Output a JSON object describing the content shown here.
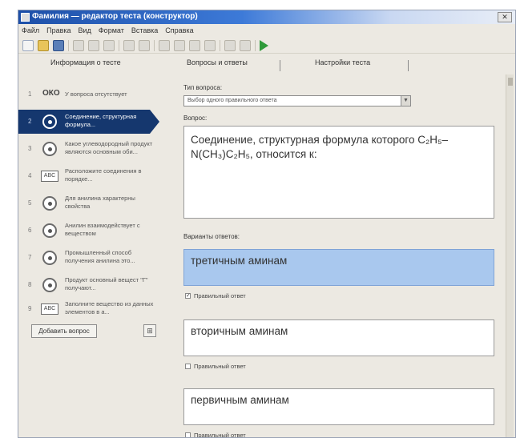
{
  "window": {
    "title": "Фамилия — редактор теста (конструктор)",
    "close_glyph": "✕"
  },
  "menu": [
    "Файл",
    "Правка",
    "Вид",
    "Формат",
    "Вставка",
    "Справка"
  ],
  "tabs": [
    "Информация о тесте",
    "Вопросы и ответы",
    "Настройки теста"
  ],
  "sidebar": {
    "items": [
      {
        "num": "1",
        "icon": "text-icon",
        "icon_text": "ОКО",
        "label": "У вопроса отсутствует"
      },
      {
        "num": "2",
        "icon": "radio-icon",
        "label": "Соединение, структурная формула...",
        "active": true
      },
      {
        "num": "3",
        "icon": "radio-icon",
        "label": "Какое углеводородный продукт являются основным оби..."
      },
      {
        "num": "4",
        "icon": "box-icon",
        "icon_text": "ABC",
        "label": "Расположите соединения в порядке..."
      },
      {
        "num": "5",
        "icon": "radio-icon",
        "label": "Для анилина характерны свойства"
      },
      {
        "num": "6",
        "icon": "radio-icon",
        "label": "Анилин взаимодействует с веществом"
      },
      {
        "num": "7",
        "icon": "radio-icon",
        "label": "Промышленный способ получения анилина это..."
      },
      {
        "num": "8",
        "icon": "radio-icon",
        "label": "Продукт основный вещест \"Г\" получают..."
      },
      {
        "num": "9",
        "icon": "box-icon",
        "icon_text": "ABC",
        "label": "Заполните вещество из данных элементов в а..."
      }
    ],
    "add_button": "Добавить вопрос",
    "extra_button_glyph": "⊞"
  },
  "main": {
    "type_label": "Тип вопроса:",
    "type_value": "Выбор одного правильного ответа",
    "question_label": "Вопрос:",
    "question_text": "Соединение, структурная формула которого C₂H₅–N(CH₃)C₂H₅, относится к:",
    "answers_label": "Варианты ответов:",
    "correct_label": "Правильный ответ",
    "answers": [
      {
        "text": "третичным аминам",
        "selected": true,
        "correct": true
      },
      {
        "text": "вторичным аминам",
        "selected": false,
        "correct": false
      },
      {
        "text": "первичным аминам",
        "selected": false,
        "correct": false
      }
    ]
  },
  "toolbar_icons": [
    "new-icon",
    "open-icon",
    "save-icon",
    "cut-icon",
    "copy-icon",
    "paste-icon",
    "undo-icon",
    "redo-icon",
    "bold-icon",
    "italic-icon",
    "align-icon",
    "list-icon",
    "image-icon",
    "formula-icon",
    "run-icon"
  ],
  "colors": {
    "title_gradient_start": "#1d4fa8",
    "active_item": "#15376e",
    "selected_answer": "#a9c8ee",
    "run_icon": "#2f9a3a"
  }
}
